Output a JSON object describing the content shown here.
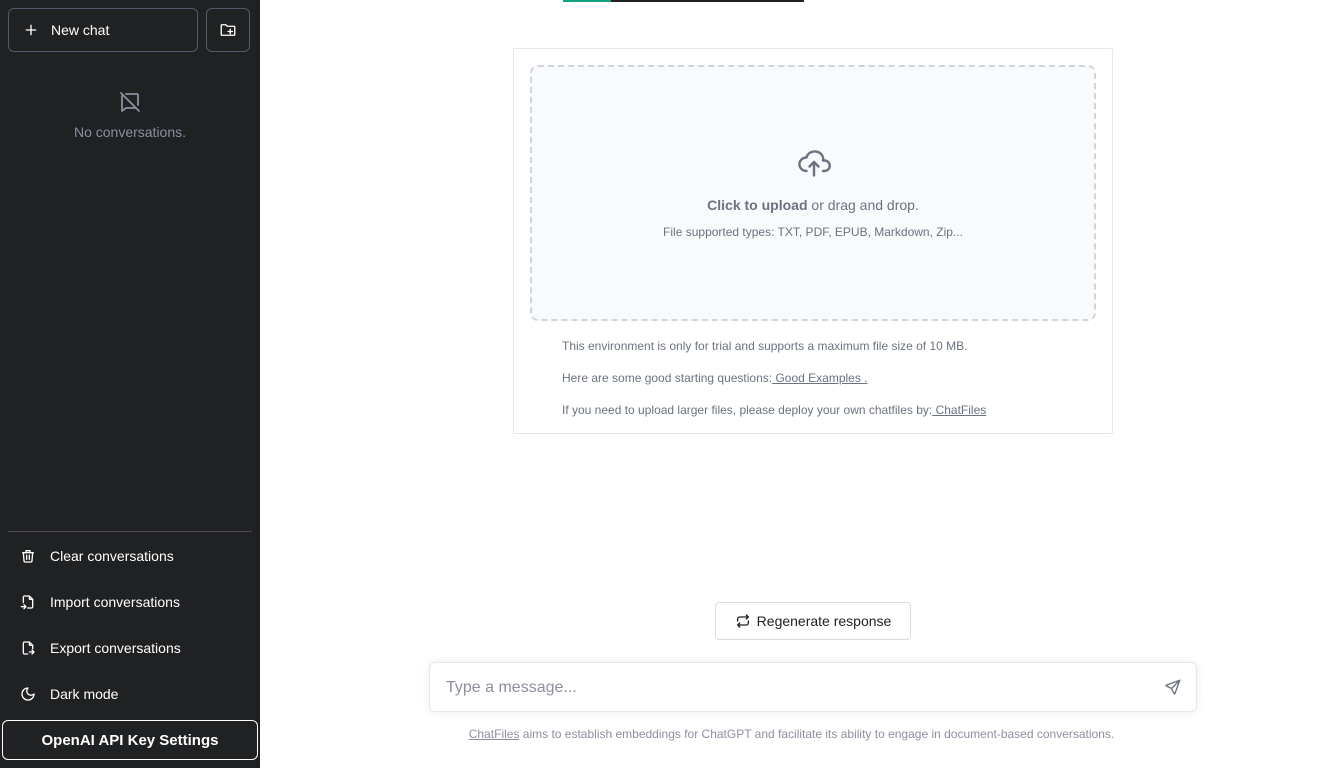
{
  "sidebar": {
    "new_chat_label": "New chat",
    "empty_label": "No conversations.",
    "menu": [
      {
        "label": "Clear conversations",
        "icon": "trash-icon"
      },
      {
        "label": "Import conversations",
        "icon": "file-import-icon"
      },
      {
        "label": "Export conversations",
        "icon": "file-export-icon"
      },
      {
        "label": "Dark mode",
        "icon": "moon-icon"
      }
    ],
    "api_key_label": "OpenAI API Key Settings"
  },
  "upload": {
    "click_label": "Click to upload",
    "drag_label": " or drag and drop.",
    "supported": "File supported types: TXT, PDF, EPUB, Markdown, Zip...",
    "note1": "This environment is only for trial and supports a maximum file size of 10 MB.",
    "note2_prefix": "Here are some good starting questions:",
    "note2_link": " Good Examples .",
    "note3_prefix": "If you need to upload larger files, please deploy your own chatfiles by:",
    "note3_link": " ChatFiles"
  },
  "progress": {
    "value": 0.2
  },
  "regenerate_label": "Regenerate response",
  "composer": {
    "placeholder": "Type a message..."
  },
  "footer": {
    "link": "ChatFiles",
    "text": " aims to establish embeddings for ChatGPT and facilitate its ability to engage in document-based conversations."
  },
  "colors": {
    "sidebar_bg": "#202123",
    "accent": "#10a37f"
  }
}
